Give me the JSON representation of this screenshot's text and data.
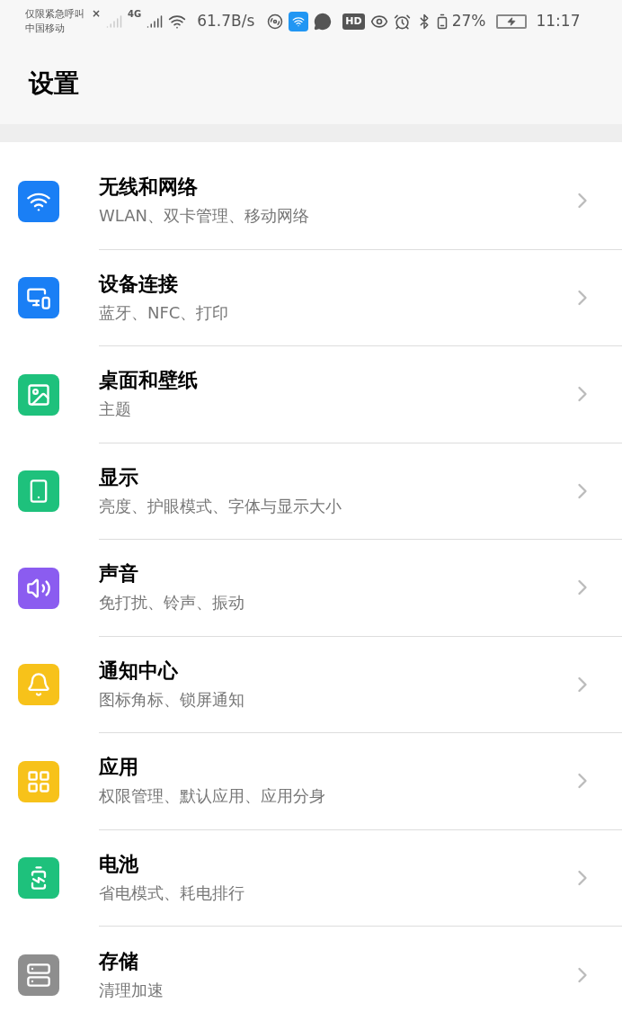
{
  "status_bar": {
    "carrier_lines": [
      "仅限紧急呼叫",
      "中国移动"
    ],
    "sim1_mark": "×",
    "network_type": "4G",
    "speed": "61.7B/s",
    "hd_badge": "HD",
    "battery_percent": "27%",
    "time": "11:17"
  },
  "header": {
    "title": "设置"
  },
  "settings": [
    {
      "color": "#1a7ff5",
      "title": "无线和网络",
      "subtitle": "WLAN、双卡管理、移动网络"
    },
    {
      "color": "#1a7ff5",
      "title": "设备连接",
      "subtitle": "蓝牙、NFC、打印"
    },
    {
      "color": "#1ec17c",
      "title": "桌面和壁纸",
      "subtitle": "主题"
    },
    {
      "color": "#1ec17c",
      "title": "显示",
      "subtitle": "亮度、护眼模式、字体与显示大小"
    },
    {
      "color": "#8b5cf0",
      "title": "声音",
      "subtitle": "免打扰、铃声、振动"
    },
    {
      "color": "#f7c21a",
      "title": "通知中心",
      "subtitle": "图标角标、锁屏通知"
    },
    {
      "color": "#f7c21a",
      "title": "应用",
      "subtitle": "权限管理、默认应用、应用分身"
    },
    {
      "color": "#1ec17c",
      "title": "电池",
      "subtitle": "省电模式、耗电排行"
    },
    {
      "color": "#8e8e8e",
      "title": "存储",
      "subtitle": "清理加速"
    }
  ]
}
